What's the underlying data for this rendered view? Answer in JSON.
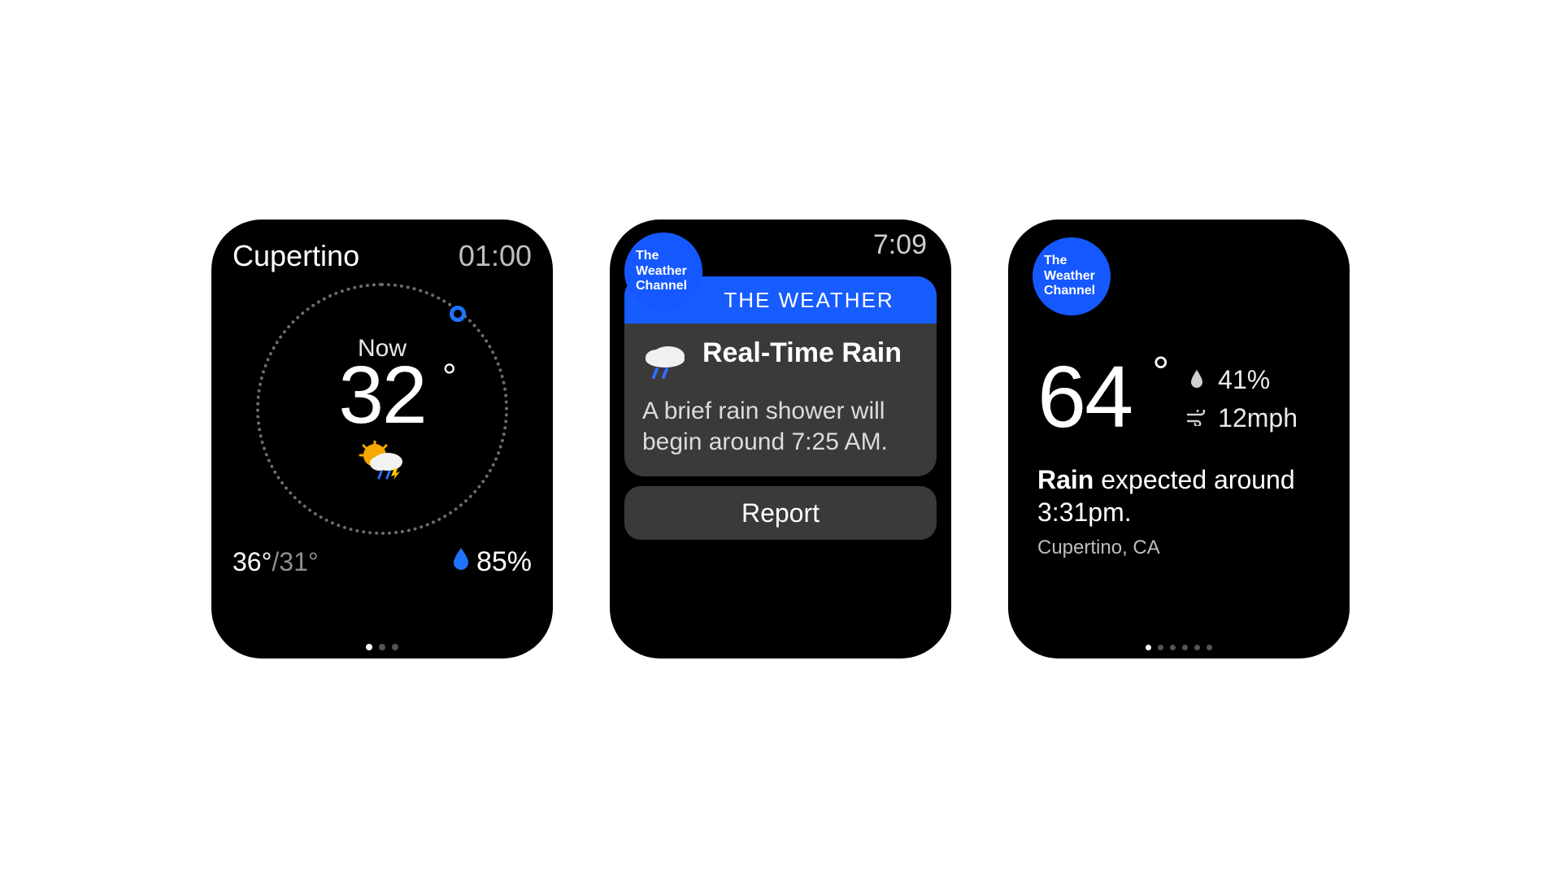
{
  "brand": {
    "logo_text": "The\nWeather\nChannel",
    "color": "#1558ff"
  },
  "screen1": {
    "location": "Cupertino",
    "time": "01:00",
    "now_label": "Now",
    "temperature": "32",
    "degree": "°",
    "high": "36°",
    "low": "31°",
    "humidity": "85%",
    "condition_icon": "sun-cloud-rain-icon",
    "pages": {
      "count": 3,
      "active_index": 0
    }
  },
  "screen2": {
    "time": "7:09",
    "header_label": "THE WEATHER",
    "alert_title": "Real-Time Rain",
    "alert_body": "A brief rain shower will begin around 7:25 AM.",
    "alert_icon": "cloud-rain-icon",
    "report_button": "Report"
  },
  "screen3": {
    "temperature": "64",
    "degree": "°",
    "precip_chance": "41%",
    "wind": "12mph",
    "forecast_bold": "Rain",
    "forecast_rest": " expected around 3:31pm.",
    "location": "Cupertino, CA",
    "pages": {
      "count": 6,
      "active_index": 0
    }
  }
}
